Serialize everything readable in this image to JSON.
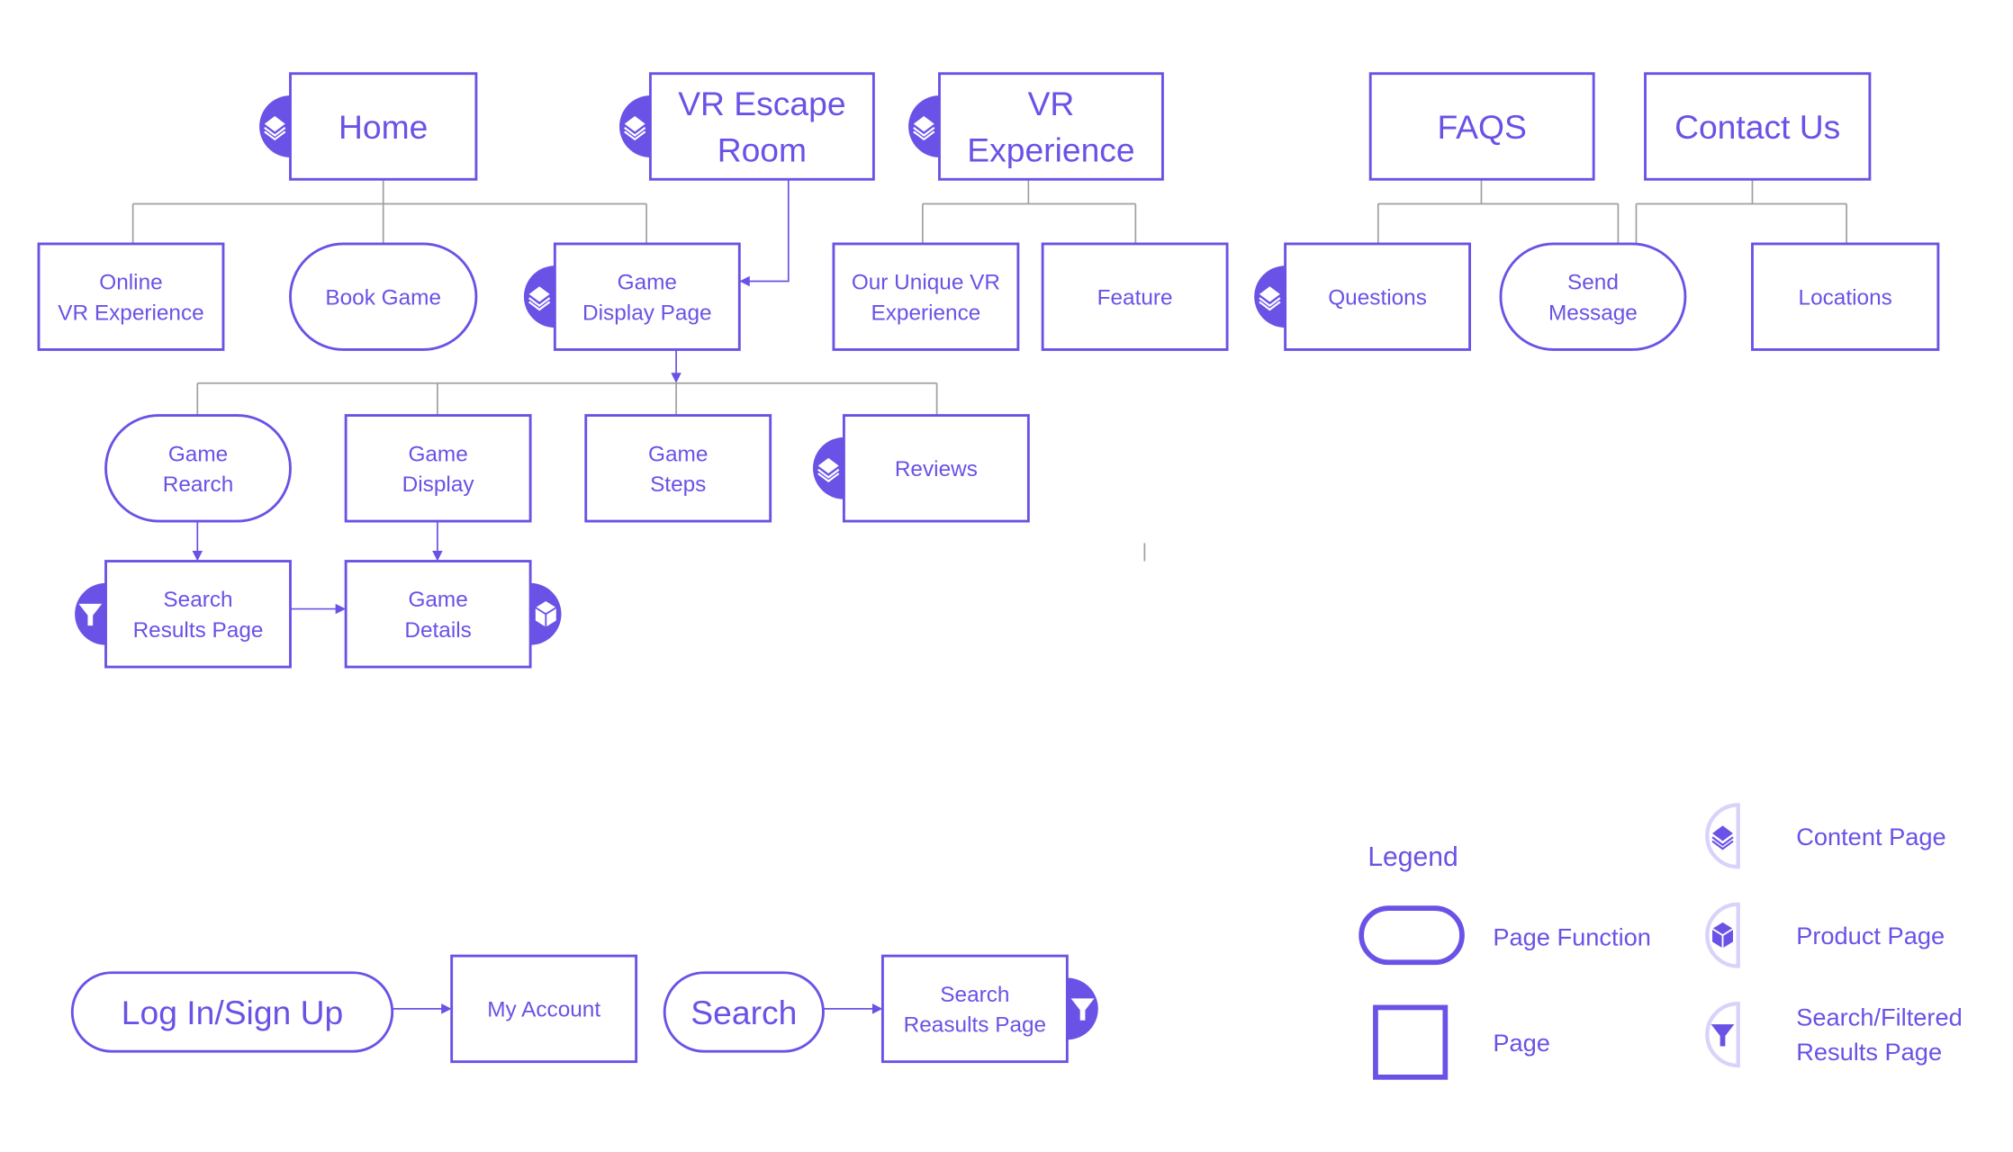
{
  "colors": {
    "accent": "#6a52e6",
    "connector": "#a0a0a0",
    "background": "#ffffff"
  },
  "nodes": {
    "home": {
      "lines": [
        "Home"
      ],
      "shape": "page",
      "icon": "content-icon"
    },
    "vr_escape_room": {
      "lines": [
        "VR Escape",
        "Room"
      ],
      "shape": "page",
      "icon": "content-icon"
    },
    "vr_experience": {
      "lines": [
        "VR",
        "Experience"
      ],
      "shape": "page",
      "icon": "content-icon"
    },
    "faqs": {
      "lines": [
        "FAQS"
      ],
      "shape": "page"
    },
    "contact_us": {
      "lines": [
        "Contact Us"
      ],
      "shape": "page"
    },
    "online_vr_experience": {
      "lines": [
        "Online",
        "VR Experience"
      ],
      "shape": "page"
    },
    "book_game": {
      "lines": [
        "Book Game"
      ],
      "shape": "page-function"
    },
    "game_display_page": {
      "lines": [
        "Game",
        "Display Page"
      ],
      "shape": "page",
      "icon": "content-icon"
    },
    "our_unique_vr_experience": {
      "lines": [
        "Our Unique VR",
        "Experience"
      ],
      "shape": "page"
    },
    "feature": {
      "lines": [
        "Feature"
      ],
      "shape": "page"
    },
    "questions": {
      "lines": [
        "Questions"
      ],
      "shape": "page",
      "icon": "content-icon"
    },
    "send_message": {
      "lines": [
        "Send",
        "Message"
      ],
      "shape": "page-function"
    },
    "locations": {
      "lines": [
        "Locations"
      ],
      "shape": "page"
    },
    "game_rearch": {
      "lines": [
        "Game",
        "Rearch"
      ],
      "shape": "page-function"
    },
    "game_display": {
      "lines": [
        "Game",
        "Display"
      ],
      "shape": "page"
    },
    "game_steps": {
      "lines": [
        "Game",
        "Steps"
      ],
      "shape": "page"
    },
    "reviews": {
      "lines": [
        "Reviews"
      ],
      "shape": "page",
      "icon": "content-icon"
    },
    "search_results_page": {
      "lines": [
        "Search",
        "Results Page"
      ],
      "shape": "page",
      "icon": "funnel-icon"
    },
    "game_details": {
      "lines": [
        "Game",
        "Details"
      ],
      "shape": "page",
      "icon": "cube-icon"
    },
    "log_in_sign_up": {
      "lines": [
        "Log In/Sign Up"
      ],
      "shape": "page-function"
    },
    "my_account": {
      "lines": [
        "My Account"
      ],
      "shape": "page"
    },
    "search": {
      "lines": [
        "Search"
      ],
      "shape": "page-function"
    },
    "search_reasults_page": {
      "lines": [
        "Search",
        "Reasults Page"
      ],
      "shape": "page",
      "icon": "funnel-icon"
    }
  },
  "legend": {
    "title": "Legend",
    "page_function": "Page Function",
    "page": "Page",
    "content_page": "Content Page",
    "product_page": "Product Page",
    "search_filtered": [
      "Search/Filtered",
      "Results Page"
    ]
  }
}
